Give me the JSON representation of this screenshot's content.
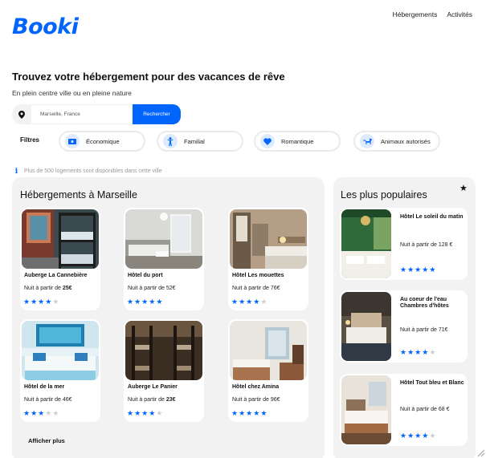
{
  "header": {
    "logo": "Booki",
    "nav": [
      "Hébergements",
      "Activités"
    ]
  },
  "hero": {
    "title": "Trouvez votre hébergement pour des vacances de rêve",
    "subtitle": "En plein centre ville ou en pleine nature"
  },
  "search": {
    "value": "Marseille, France",
    "button": "Rechercher",
    "icon": "map-pin-icon"
  },
  "filters": {
    "label": "Filtres",
    "items": [
      {
        "label": "Économique",
        "icon": "money-icon"
      },
      {
        "label": "Familial",
        "icon": "child-icon"
      },
      {
        "label": "Romantique",
        "icon": "heart-icon"
      },
      {
        "label": "Animaux autorisés",
        "icon": "dog-icon"
      }
    ]
  },
  "info": "Plus de 500 logements sont disponibles dans cette ville",
  "colors": {
    "accent": "#0065fc",
    "panel": "#f2f2f2",
    "star_off": "#cfcfcf"
  },
  "main": {
    "title": "Hébergements à Marseille",
    "show_more": "Afficher plus",
    "cards": [
      {
        "name": "Auberge La Cannebière",
        "price_prefix": "Nuit à partir de",
        "price": "25€",
        "price_bold": true,
        "stars": 4
      },
      {
        "name": "Hôtel du port",
        "price_prefix": "Nuit à partir de",
        "price": "52€",
        "price_bold": false,
        "stars": 5
      },
      {
        "name": "Hôtel Les mouettes",
        "price_prefix": "Nuit à partir de",
        "price": "76€",
        "price_bold": false,
        "stars": 4
      },
      {
        "name": "Hôtel de la mer",
        "price_prefix": "Nuit à partir de",
        "price": "46€",
        "price_bold": false,
        "stars": 3
      },
      {
        "name": "Auberge Le Panier",
        "price_prefix": "Nuit à partir de",
        "price": "23€",
        "price_bold": true,
        "stars": 4
      },
      {
        "name": "Hôtel chez Amina",
        "price_prefix": "Nuit à partir de",
        "price": "96€",
        "price_bold": false,
        "stars": 5
      }
    ]
  },
  "popular": {
    "title": "Les plus populaires",
    "icon": "star-icon",
    "cards": [
      {
        "name": "Hôtel Le soleil du matin",
        "price_text": "Nuit à partir de 128 €",
        "stars": 5
      },
      {
        "name": "Au coeur de l'eau Chambres d'hôtes",
        "price_text": "Nuit à partir de 71€",
        "stars": 4
      },
      {
        "name": "Hôtel Tout bleu et Blanc",
        "price_text": "Nuit à partir de 68 €",
        "stars": 4
      }
    ]
  }
}
